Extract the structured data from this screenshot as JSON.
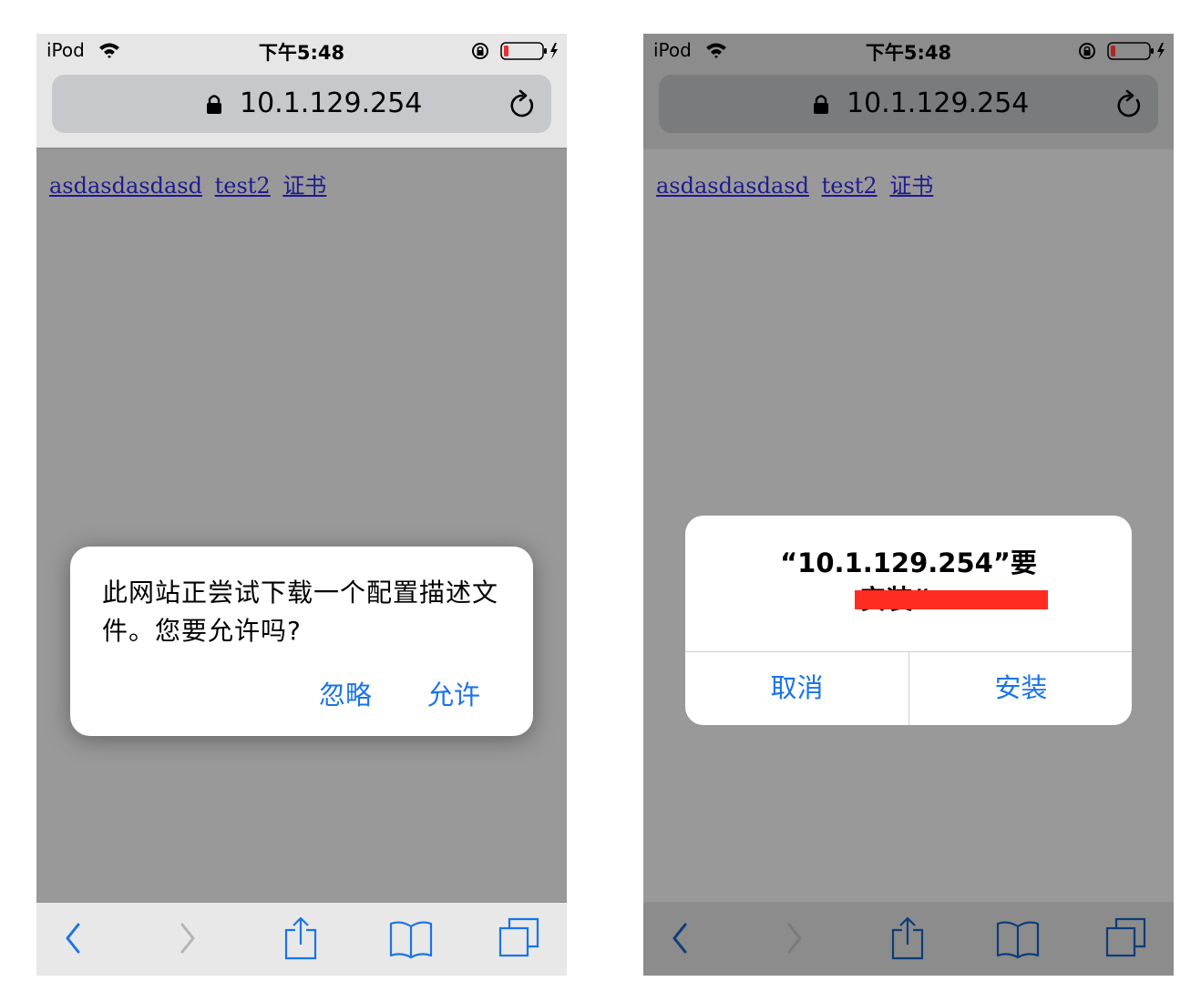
{
  "colors": {
    "accent": "#1a73e8",
    "page_bg": "#999999",
    "link": "#1f1a8f",
    "battery_low": "#e8322b",
    "redaction": "#ff2d21"
  },
  "status_bar": {
    "carrier": "iPod",
    "time": "下午5:48"
  },
  "url_bar": {
    "address": "10.1.129.254"
  },
  "page_links": [
    "asdasdasdasd",
    "test2",
    "证书"
  ],
  "toolbar_icons": [
    "back-icon",
    "forward-icon",
    "share-icon",
    "bookmarks-icon",
    "tabs-icon"
  ],
  "screen_left": {
    "dialog": {
      "message": "此网站正尝试下载一个配置描述文件。您要允许吗?",
      "ignore_label": "忽略",
      "allow_label": "允许"
    }
  },
  "screen_right": {
    "dialog": {
      "title_line1": "“10.1.129.254”要",
      "title_line2": "安装“",
      "cancel_label": "取消",
      "install_label": "安装"
    }
  }
}
